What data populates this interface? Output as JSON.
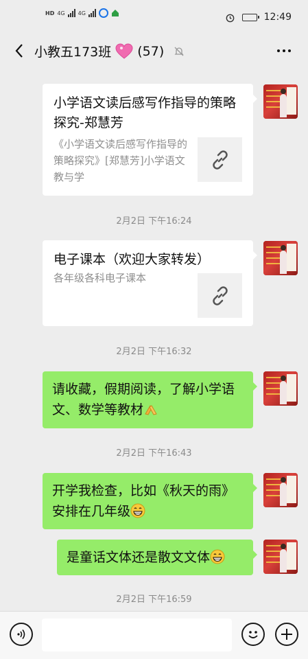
{
  "status_bar": {
    "left_labels": [
      "HD",
      "4G",
      "4G"
    ],
    "time": "12:49"
  },
  "header": {
    "title": "小教五173班",
    "member_count": "(57)"
  },
  "messages": [
    {
      "type": "link",
      "title": "小学语文读后感写作指导的策略探究-郑慧芳",
      "description": "《小学语文读后感写作指导的策略探究》[郑慧芳]小学语文教与学",
      "icon": "link-icon"
    },
    {
      "type": "time",
      "text": "2月2日 下午16:24"
    },
    {
      "type": "link",
      "title": "电子课本（欢迎大家转发）",
      "description": "各年级各科电子课本",
      "icon": "link-icon"
    },
    {
      "type": "time",
      "text": "2月2日 下午16:32"
    },
    {
      "type": "text",
      "text": "请收藏，假期阅读，了解小学语文、数学等教材",
      "emoji": "bowing-hands-emoji"
    },
    {
      "type": "time",
      "text": "2月2日 下午16:43"
    },
    {
      "type": "text",
      "text": "开学我检查，比如《秋天的雨》安排在几年级",
      "emoji": "grinning-face-emoji"
    },
    {
      "type": "text",
      "text": "是童话文体还是散文文体",
      "emoji": "grinning-face-emoji"
    },
    {
      "type": "time",
      "text": "2月2日 下午16:59"
    }
  ],
  "input_bar": {
    "placeholder": "",
    "icons": [
      "voice-icon",
      "emoji-icon",
      "plus-icon"
    ]
  },
  "colors": {
    "background": "#ededed",
    "bubble_green": "#95ec69",
    "card_white": "#ffffff",
    "timestamp_gray": "#8a8a8a"
  }
}
